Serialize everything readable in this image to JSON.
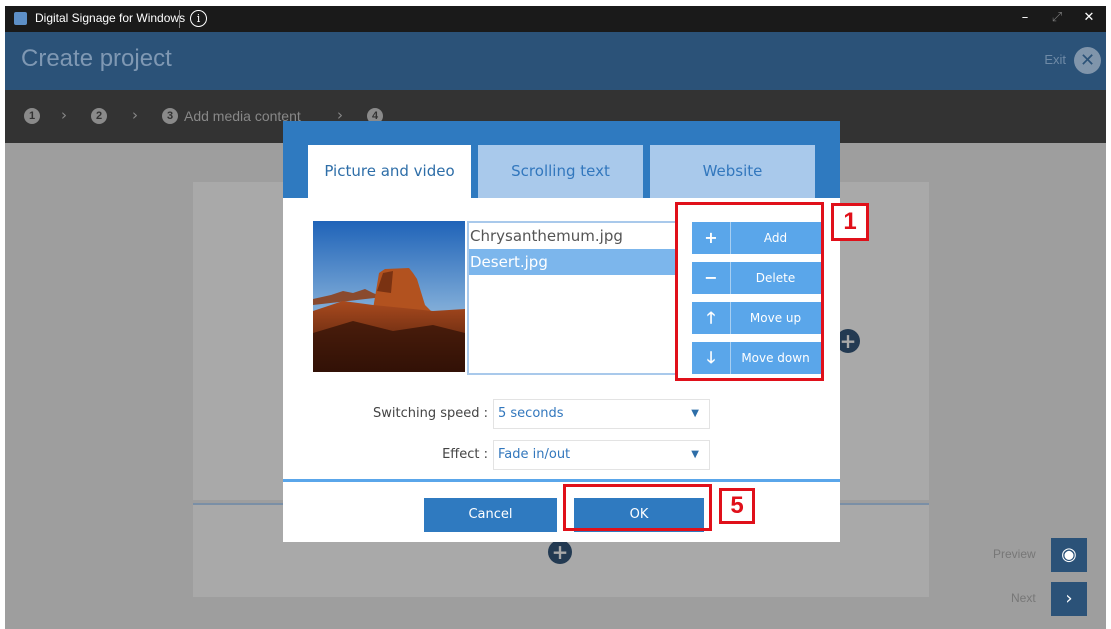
{
  "window": {
    "app_title": "Digital Signage for Windows",
    "info_icon": "i",
    "controls": {
      "minimize": "–",
      "maximize": "⤢",
      "close": "✕"
    }
  },
  "header": {
    "title": "Create project",
    "exit_label": "Exit"
  },
  "steps": [
    {
      "number": "1",
      "label": ""
    },
    {
      "number": "2",
      "label": ""
    },
    {
      "number": "3",
      "label": "Add media content"
    },
    {
      "number": "4",
      "label": ""
    }
  ],
  "side": {
    "preview_label": "Preview",
    "next_label": "Next"
  },
  "dialog": {
    "tabs": [
      {
        "label": "Picture and video",
        "active": true
      },
      {
        "label": "Scrolling text",
        "active": false
      },
      {
        "label": "Website",
        "active": false
      }
    ],
    "files": [
      {
        "name": "Chrysanthemum.jpg",
        "selected": false
      },
      {
        "name": "Desert.jpg",
        "selected": true
      }
    ],
    "actions": [
      {
        "icon": "plus-icon",
        "label": "Add"
      },
      {
        "icon": "minus-icon",
        "label": "Delete"
      },
      {
        "icon": "arrow-up-icon",
        "label": "Move up"
      },
      {
        "icon": "arrow-down-icon",
        "label": "Move down"
      }
    ],
    "switching_speed": {
      "label": "Switching speed :",
      "value": "5 seconds"
    },
    "effect": {
      "label": "Effect :",
      "value": "Fade in/out"
    },
    "cancel_label": "Cancel",
    "ok_label": "OK"
  },
  "annotations": {
    "marker_1": "1",
    "marker_5": "5"
  },
  "colors": {
    "header_blue": "#2b5278",
    "dialog_blue": "#2f7ac0",
    "action_blue": "#5aa6ea",
    "annotation_red": "#e0101a"
  }
}
